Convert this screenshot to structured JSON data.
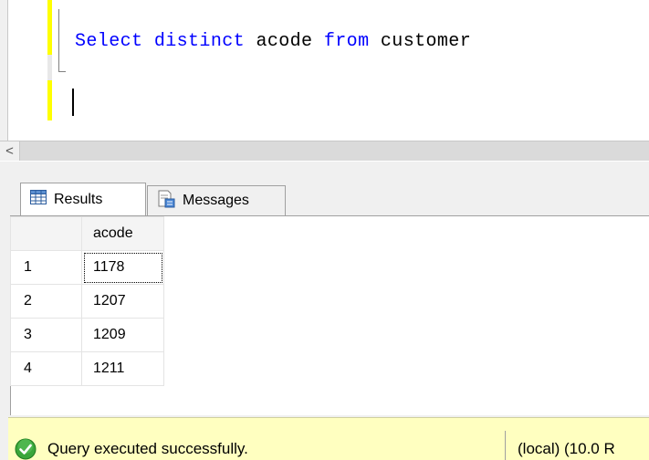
{
  "editor": {
    "kw_select": "Select",
    "kw_distinct": "distinct",
    "ident_column": "acode",
    "kw_from": "from",
    "ident_table": "customer"
  },
  "scrollbar": {
    "left_arrow": "<"
  },
  "tabs": [
    {
      "label": "Results",
      "icon": "grid-icon",
      "active": true
    },
    {
      "label": "Messages",
      "icon": "messages-icon",
      "active": false
    }
  ],
  "grid": {
    "columns": [
      "acode"
    ],
    "rows": [
      {
        "num": "1",
        "acode": "1178"
      },
      {
        "num": "2",
        "acode": "1207"
      },
      {
        "num": "3",
        "acode": "1209"
      },
      {
        "num": "4",
        "acode": "1211"
      }
    ]
  },
  "status": {
    "message": "Query executed successfully.",
    "server": "(local) (10.0 R",
    "icon": "check-circle-icon",
    "bar_color": "#ffffc0",
    "success_color": "#3aa63a"
  },
  "colors": {
    "keyword": "#0000ff",
    "margin_changed": "#ffff00"
  }
}
